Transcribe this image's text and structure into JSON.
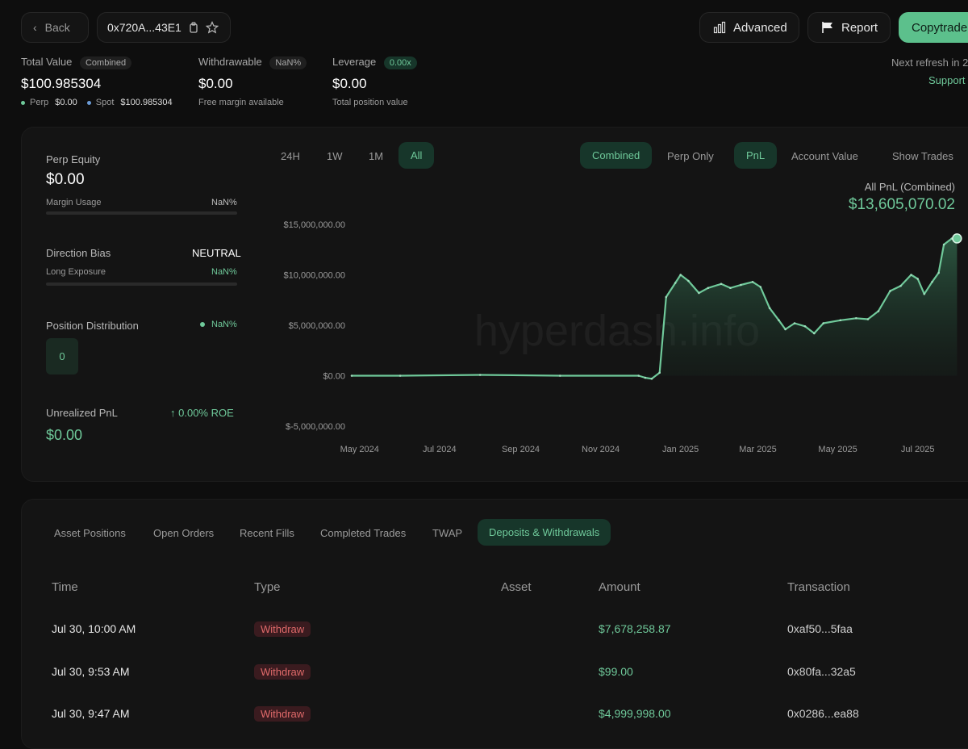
{
  "header": {
    "back_label": "Back",
    "address": "0x720A...43E1",
    "advanced_label": "Advanced",
    "report_label": "Report",
    "copytrade_label": "Copytrade",
    "next_refresh": "Next refresh in 2",
    "support": "Support"
  },
  "summary": {
    "total_value_label": "Total Value",
    "total_value_badge": "Combined",
    "total_value": "$100.985304",
    "perp_label": "Perp",
    "perp_value": "$0.00",
    "spot_label": "Spot",
    "spot_value": "$100.985304",
    "withdrawable_label": "Withdrawable",
    "withdrawable_badge": "NaN%",
    "withdrawable_value": "$0.00",
    "withdrawable_sub": "Free margin available",
    "leverage_label": "Leverage",
    "leverage_badge": "0.00x",
    "leverage_value": "$0.00",
    "leverage_sub": "Total position value"
  },
  "side": {
    "perp_equity_label": "Perp Equity",
    "perp_equity_value": "$0.00",
    "margin_usage_label": "Margin Usage",
    "margin_usage_value": "NaN%",
    "direction_bias_label": "Direction Bias",
    "direction_bias_value": "NEUTRAL",
    "long_exposure_label": "Long Exposure",
    "long_exposure_value": "NaN%",
    "position_distribution_label": "Position Distribution",
    "position_distribution_value": "NaN%",
    "position_distribution_count": "0",
    "unrealized_pnl_label": "Unrealized PnL",
    "roe_value": "0.00% ROE",
    "unrealized_pnl_value": "$0.00"
  },
  "chart_controls": {
    "ranges": [
      "24H",
      "1W",
      "1M",
      "All"
    ],
    "active_range": "All",
    "combined": "Combined",
    "perp_only": "Perp Only",
    "pnl": "PnL",
    "account_value": "Account Value",
    "show_trades": "Show Trades",
    "pnl_title": "All PnL (Combined)",
    "pnl_value": "$13,605,070.02",
    "watermark": "hyperdash.info"
  },
  "chart_data": {
    "type": "area",
    "title": "All PnL (Combined)",
    "y_ticks": [
      "$15,000,000.00",
      "$10,000,000.00",
      "$5,000,000.00",
      "$0.00",
      "$-5,000,000.00"
    ],
    "x_ticks": [
      "May 2024",
      "Jul 2024",
      "Sep 2024",
      "Nov 2024",
      "Jan 2025",
      "Mar 2025",
      "May 2025",
      "Jul 2025"
    ],
    "ylim": [
      -5000000,
      15000000
    ],
    "x_start": "2024-04-25",
    "x_end": "2025-08-01",
    "series": [
      {
        "name": "PnL",
        "points": [
          [
            "2024-04-25",
            0
          ],
          [
            "2024-06-01",
            0
          ],
          [
            "2024-08-01",
            80000
          ],
          [
            "2024-10-01",
            0
          ],
          [
            "2024-11-30",
            0
          ],
          [
            "2024-12-05",
            -200000
          ],
          [
            "2024-12-10",
            -300000
          ],
          [
            "2024-12-16",
            300000
          ],
          [
            "2024-12-21",
            7800000
          ],
          [
            "2024-12-28",
            9200000
          ],
          [
            "2025-01-01",
            10000000
          ],
          [
            "2025-01-07",
            9400000
          ],
          [
            "2025-01-15",
            8200000
          ],
          [
            "2025-01-22",
            8700000
          ],
          [
            "2025-02-01",
            9100000
          ],
          [
            "2025-02-08",
            8700000
          ],
          [
            "2025-02-16",
            9000000
          ],
          [
            "2025-02-25",
            9300000
          ],
          [
            "2025-03-03",
            8800000
          ],
          [
            "2025-03-10",
            6700000
          ],
          [
            "2025-03-17",
            5500000
          ],
          [
            "2025-03-22",
            4600000
          ],
          [
            "2025-03-29",
            5200000
          ],
          [
            "2025-04-06",
            4900000
          ],
          [
            "2025-04-13",
            4200000
          ],
          [
            "2025-04-20",
            5200000
          ],
          [
            "2025-05-03",
            5500000
          ],
          [
            "2025-05-15",
            5700000
          ],
          [
            "2025-05-24",
            5600000
          ],
          [
            "2025-06-01",
            6400000
          ],
          [
            "2025-06-10",
            8400000
          ],
          [
            "2025-06-18",
            8900000
          ],
          [
            "2025-06-26",
            10000000
          ],
          [
            "2025-07-01",
            9600000
          ],
          [
            "2025-07-06",
            8100000
          ],
          [
            "2025-07-12",
            9300000
          ],
          [
            "2025-07-17",
            10200000
          ],
          [
            "2025-07-21",
            13000000
          ],
          [
            "2025-07-27",
            13600000
          ],
          [
            "2025-07-31",
            13605070.02
          ]
        ]
      }
    ],
    "color": "#6fc99a"
  },
  "table": {
    "tabs": [
      "Asset Positions",
      "Open Orders",
      "Recent Fills",
      "Completed Trades",
      "TWAP",
      "Deposits & Withdrawals"
    ],
    "active_tab": "Deposits & Withdrawals",
    "columns": [
      "Time",
      "Type",
      "Asset",
      "Amount",
      "Transaction"
    ],
    "rows": [
      {
        "time": "Jul 30, 10:00 AM",
        "type": "Withdraw",
        "asset": "",
        "amount": "$7,678,258.87",
        "tx": "0xaf50...5faa"
      },
      {
        "time": "Jul 30, 9:53 AM",
        "type": "Withdraw",
        "asset": "",
        "amount": "$99.00",
        "tx": "0x80fa...32a5"
      },
      {
        "time": "Jul 30, 9:47 AM",
        "type": "Withdraw",
        "asset": "",
        "amount": "$4,999,998.00",
        "tx": "0x0286...ea88"
      }
    ]
  }
}
